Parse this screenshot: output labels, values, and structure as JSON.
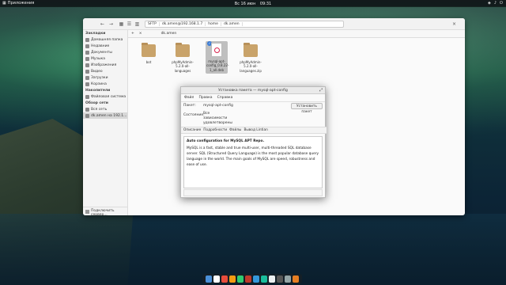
{
  "top_panel": {
    "apps_label": "Приложения",
    "date": "Вс 16 июн",
    "time": "09:31"
  },
  "file_manager": {
    "toolbar": {
      "back": "←",
      "forward": "→",
      "path_segments": [
        "SFTP",
        "dk.amen@192.168.1.7",
        "home",
        "dk.amen"
      ]
    },
    "sidebar": {
      "bookmarks_heading": "Закладки",
      "bookmarks": [
        "Домашняя папка",
        "Недавние",
        "Документы",
        "Музыка",
        "Изображения",
        "Видео",
        "Загрузки",
        "Корзина"
      ],
      "devices_heading": "Накопители",
      "devices": [
        "Файловая система"
      ],
      "network_heading": "Обзор сети",
      "network": [
        "Вся сеть",
        "dk.amen на 192.1..."
      ],
      "connect_label": "Подключить сервер..."
    },
    "tab_label": "dk.amen",
    "files": [
      {
        "name": "bot",
        "type": "folder"
      },
      {
        "name": "phpMyAdmin-5.2.0-all-languages",
        "type": "folder"
      },
      {
        "name": "mysql-apt-config_0.8.22-1_all.deb",
        "type": "deb"
      },
      {
        "name": "phpMyAdmin-5.2.0-all-languages.zip",
        "type": "folder"
      }
    ]
  },
  "dialog": {
    "title": "Установка пакета — mysql-apt-config",
    "menu": [
      "Файл",
      "Правка",
      "Справка"
    ],
    "package_label": "Пакет:",
    "package_value": "mysql-apt-config",
    "install_button": "Установить пакет",
    "status_label": "Состояние:",
    "status_value": "Все зависимости удовлетворены",
    "tabs": [
      "Описание",
      "Подробности",
      "Файлы",
      "Вывод Lintian"
    ],
    "desc_heading": "Auto configuration for MySQL APT Repo.",
    "desc_body": "MySQL is a fast, stable and true multi-user, multi-threaded SQL database server. SQL (Structured Query Language) is the most popular database query language in the world. The main goals of MySQL are speed, robustness and ease of use."
  },
  "dock_colors": [
    "#4a90d9",
    "#ffffff",
    "#e74c3c",
    "#f39c12",
    "#2ecc71",
    "#c0392b",
    "#3498db",
    "#1abc9c",
    "#ecf0f1",
    "#555555",
    "#95a5a6",
    "#e67e22"
  ]
}
